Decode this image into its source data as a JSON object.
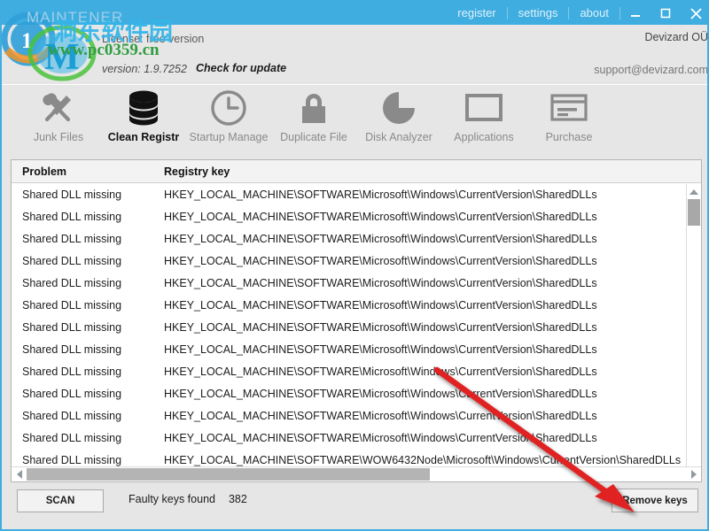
{
  "titlebar": {
    "links": [
      {
        "label": "register",
        "name": "register-link"
      },
      {
        "label": "settings",
        "name": "settings-link"
      },
      {
        "label": "about",
        "name": "about-link"
      }
    ],
    "minimize": "minimize-button",
    "maximize": "maximize-button",
    "close": "close-button"
  },
  "header": {
    "license": "License: free version",
    "version": "version: 1.9.7252",
    "check_update": "Check for update",
    "company": "Devizard OÜ",
    "support": "support@devizard.com"
  },
  "watermark": {
    "brand": "MAINTENER",
    "cn_text": "洞东软件园",
    "url": "www.pc0359.cn"
  },
  "toolbar": {
    "items": [
      {
        "label": "Junk Files",
        "icon": "tools-icon",
        "active": false
      },
      {
        "label": "Clean Registr",
        "icon": "database-icon",
        "active": true
      },
      {
        "label": "Startup Manage",
        "icon": "clock-icon",
        "active": false
      },
      {
        "label": "Duplicate File",
        "icon": "lock-icon",
        "active": false
      },
      {
        "label": "Disk Analyzer",
        "icon": "pie-chart-icon",
        "active": false
      },
      {
        "label": "Applications",
        "icon": "window-icon",
        "active": false
      },
      {
        "label": "Purchase",
        "icon": "credit-card-icon",
        "active": false
      }
    ]
  },
  "grid": {
    "columns": [
      "Problem",
      "Registry key"
    ],
    "rows": [
      {
        "problem": "Shared DLL missing",
        "key": "HKEY_LOCAL_MACHINE\\SOFTWARE\\Microsoft\\Windows\\CurrentVersion\\SharedDLLs"
      },
      {
        "problem": "Shared DLL missing",
        "key": "HKEY_LOCAL_MACHINE\\SOFTWARE\\Microsoft\\Windows\\CurrentVersion\\SharedDLLs"
      },
      {
        "problem": "Shared DLL missing",
        "key": "HKEY_LOCAL_MACHINE\\SOFTWARE\\Microsoft\\Windows\\CurrentVersion\\SharedDLLs"
      },
      {
        "problem": "Shared DLL missing",
        "key": "HKEY_LOCAL_MACHINE\\SOFTWARE\\Microsoft\\Windows\\CurrentVersion\\SharedDLLs"
      },
      {
        "problem": "Shared DLL missing",
        "key": "HKEY_LOCAL_MACHINE\\SOFTWARE\\Microsoft\\Windows\\CurrentVersion\\SharedDLLs"
      },
      {
        "problem": "Shared DLL missing",
        "key": "HKEY_LOCAL_MACHINE\\SOFTWARE\\Microsoft\\Windows\\CurrentVersion\\SharedDLLs"
      },
      {
        "problem": "Shared DLL missing",
        "key": "HKEY_LOCAL_MACHINE\\SOFTWARE\\Microsoft\\Windows\\CurrentVersion\\SharedDLLs"
      },
      {
        "problem": "Shared DLL missing",
        "key": "HKEY_LOCAL_MACHINE\\SOFTWARE\\Microsoft\\Windows\\CurrentVersion\\SharedDLLs"
      },
      {
        "problem": "Shared DLL missing",
        "key": "HKEY_LOCAL_MACHINE\\SOFTWARE\\Microsoft\\Windows\\CurrentVersion\\SharedDLLs"
      },
      {
        "problem": "Shared DLL missing",
        "key": "HKEY_LOCAL_MACHINE\\SOFTWARE\\Microsoft\\Windows\\CurrentVersion\\SharedDLLs"
      },
      {
        "problem": "Shared DLL missing",
        "key": "HKEY_LOCAL_MACHINE\\SOFTWARE\\Microsoft\\Windows\\CurrentVersion\\SharedDLLs"
      },
      {
        "problem": "Shared DLL missing",
        "key": "HKEY_LOCAL_MACHINE\\SOFTWARE\\Microsoft\\Windows\\CurrentVersion\\SharedDLLs"
      },
      {
        "problem": "Shared DLL missing",
        "key": "HKEY_LOCAL_MACHINE\\SOFTWARE\\WOW6432Node\\Microsoft\\Windows\\CurrentVersion\\SharedDLLs"
      }
    ]
  },
  "bottom": {
    "scan_label": "SCAN",
    "status_label": "Faulty keys found",
    "status_count": "382",
    "remove_label": "Remove keys"
  },
  "colors": {
    "accent": "#3fade0",
    "chrome": "#e6e6e6",
    "annotation": "#e02020"
  }
}
